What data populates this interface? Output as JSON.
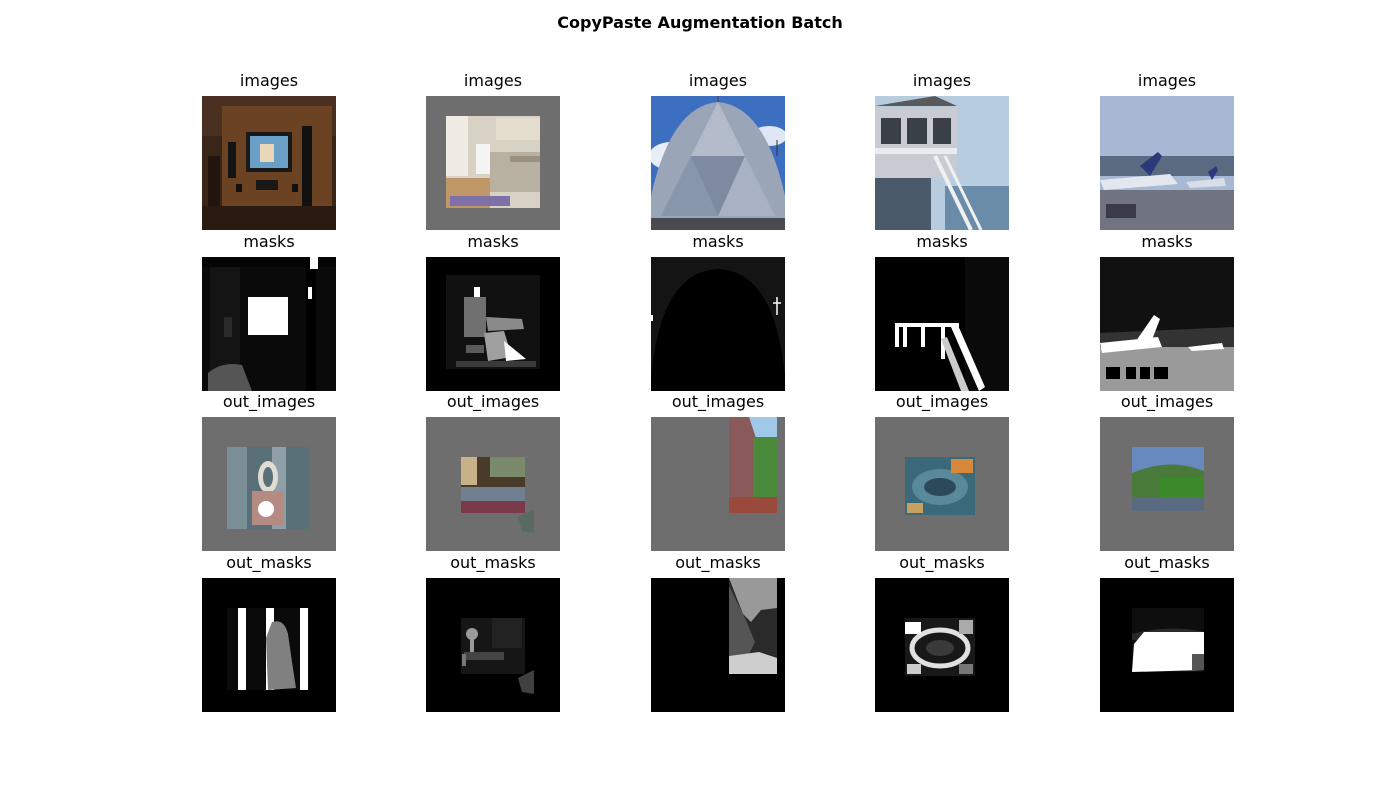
{
  "figure": {
    "title": "CopyPaste Augmentation Batch"
  },
  "rows": [
    {
      "label": "images"
    },
    {
      "label": "masks"
    },
    {
      "label": "out_images"
    },
    {
      "label": "out_masks"
    }
  ],
  "columns_count": 5,
  "panel_titles": [
    [
      "images",
      "images",
      "images",
      "images",
      "images"
    ],
    [
      "masks",
      "masks",
      "masks",
      "masks",
      "masks"
    ],
    [
      "out_images",
      "out_images",
      "out_images",
      "out_images",
      "out_images"
    ],
    [
      "out_masks",
      "out_masks",
      "out_masks",
      "out_masks",
      "out_masks"
    ]
  ],
  "colors": {
    "padding_gray": "#6e6e6e",
    "mask_background": "#000000"
  }
}
